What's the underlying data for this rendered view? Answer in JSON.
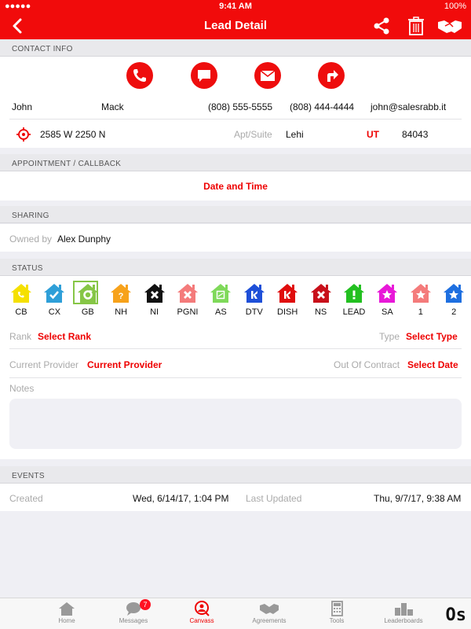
{
  "status_bar": {
    "left": "●●●●● ",
    "time": "9:41 AM",
    "right": "100%"
  },
  "nav": {
    "title": "Lead Detail"
  },
  "contact_info": {
    "header": "CONTACT INFO",
    "first_name": "John",
    "last_name": "Mack",
    "phone1": "(808) 555-5555",
    "phone2": "(808) 444-4444",
    "email": "john@salesrabb.it",
    "address": "2585 W 2250 N",
    "apt_placeholder": "Apt/Suite",
    "city": "Lehi",
    "state": "UT",
    "zip": "84043"
  },
  "appointment": {
    "header": "APPOINTMENT / CALLBACK",
    "date_time_label": "Date and Time"
  },
  "sharing": {
    "header": "SHARING",
    "owned_by_label": "Owned by",
    "owner": "Alex Dunphy"
  },
  "status": {
    "header": "STATUS",
    "items": [
      {
        "label": "CB",
        "color": "#f5e000",
        "glyph": "phone"
      },
      {
        "label": "CX",
        "color": "#2e9fd8",
        "glyph": "check"
      },
      {
        "label": "GB",
        "color": "#86c646",
        "glyph": "cycle",
        "selected": true
      },
      {
        "label": "NH",
        "color": "#f7a21b",
        "glyph": "question"
      },
      {
        "label": "NI",
        "color": "#111111",
        "glyph": "x"
      },
      {
        "label": "PGNI",
        "color": "#f47b7b",
        "glyph": "x"
      },
      {
        "label": "AS",
        "color": "#7fd95a",
        "glyph": "box"
      },
      {
        "label": "DTV",
        "color": "#1e4fd8",
        "glyph": "k"
      },
      {
        "label": "DISH",
        "color": "#e00d0d",
        "glyph": "k"
      },
      {
        "label": "NS",
        "color": "#c8101a",
        "glyph": "x"
      },
      {
        "label": "LEAD",
        "color": "#22c020",
        "glyph": "bang"
      },
      {
        "label": "SA",
        "color": "#e818d8",
        "glyph": "star"
      },
      {
        "label": "1",
        "color": "#f47b7b",
        "glyph": "star"
      },
      {
        "label": "2",
        "color": "#1e6fe0",
        "glyph": "star"
      }
    ],
    "rank_label": "Rank",
    "rank_value": "Select Rank",
    "type_label": "Type",
    "type_value": "Select Type",
    "provider_label": "Current Provider",
    "provider_value": "Current Provider",
    "contract_label": "Out Of Contract",
    "contract_value": "Select Date",
    "notes_label": "Notes"
  },
  "events": {
    "header": "EVENTS",
    "created_label": "Created",
    "created_value": "Wed, 6/14/17, 1:04 PM",
    "updated_label": "Last Updated",
    "updated_value": "Thu, 9/7/17, 9:38 AM"
  },
  "tabbar": {
    "tabs": [
      {
        "label": "Home",
        "icon": "home-icon"
      },
      {
        "label": "Messages",
        "icon": "chat-icon",
        "badge": "7"
      },
      {
        "label": "Canvass",
        "icon": "canvass-icon",
        "active": true
      },
      {
        "label": "Agreements",
        "icon": "handshake-icon"
      },
      {
        "label": "Tools",
        "icon": "calculator-icon"
      },
      {
        "label": "Leaderboards",
        "icon": "podium-icon"
      }
    ]
  },
  "logo_text": "Os",
  "colors": {
    "brand_red": "#f10b0b",
    "accent_red": "#e00000"
  }
}
